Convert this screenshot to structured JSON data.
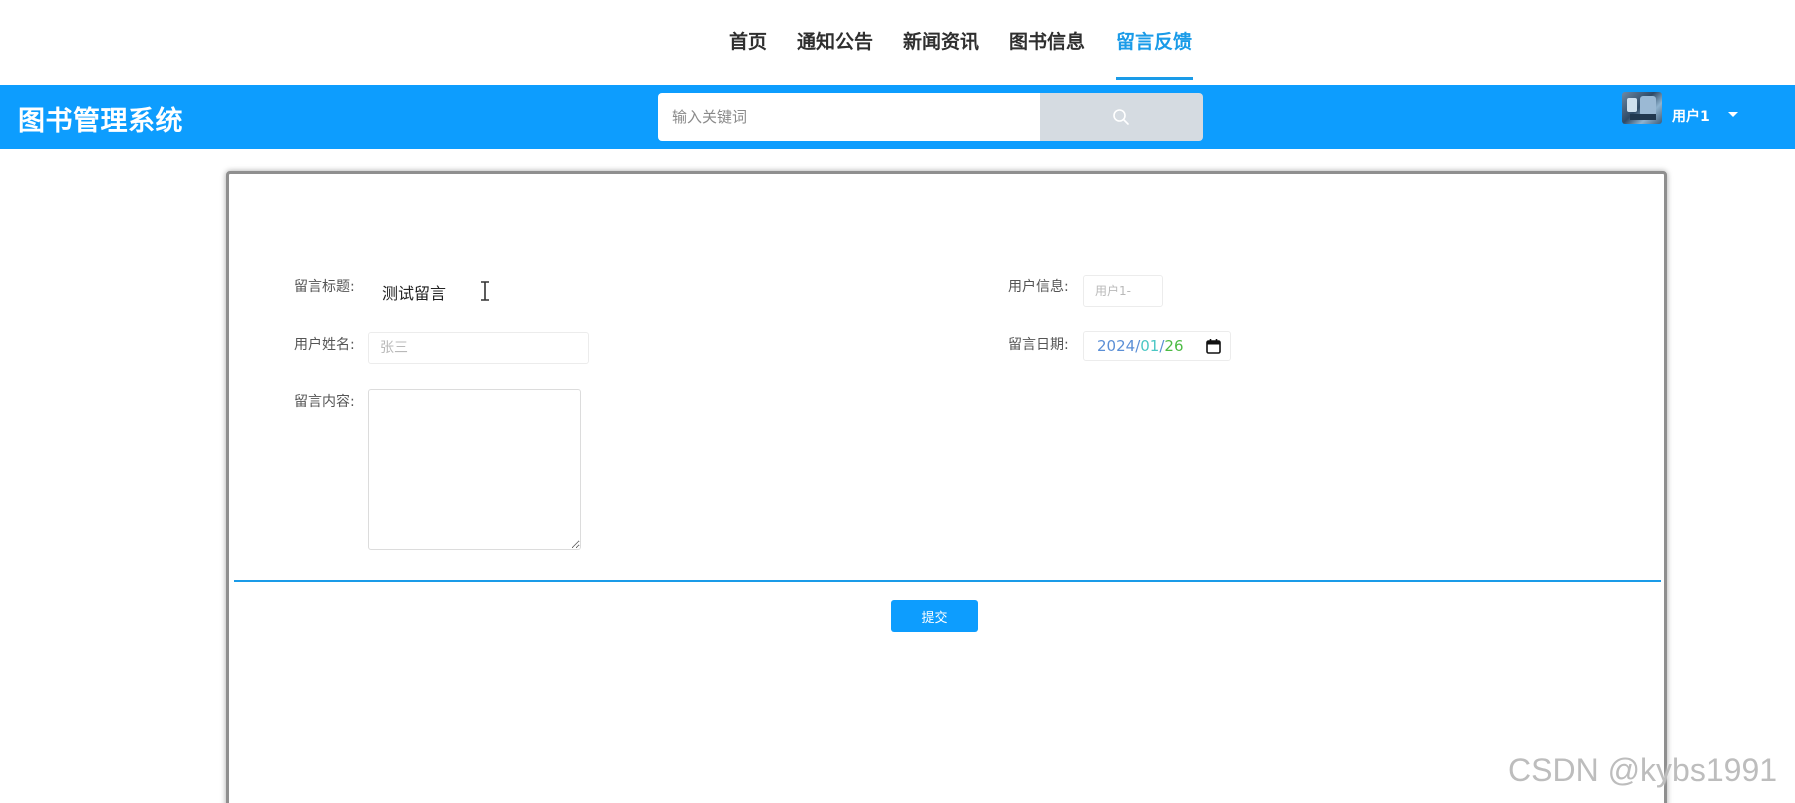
{
  "nav": {
    "items": [
      {
        "label": "首页"
      },
      {
        "label": "通知公告"
      },
      {
        "label": "新闻资讯"
      },
      {
        "label": "图书信息"
      },
      {
        "label": "留言反馈",
        "active": true
      }
    ]
  },
  "header": {
    "brand": "图书管理系统",
    "search_placeholder": "输入关键词",
    "search_icon": "search-icon",
    "username": "用户1",
    "bar_color": "#0d9dfe"
  },
  "form": {
    "title_label": "留言标题:",
    "title_value": "测试留言",
    "user_info_label": "用户信息:",
    "user_info_value": "用户1-",
    "user_name_label": "用户姓名:",
    "user_name_placeholder": "张三",
    "date_label": "留言日期:",
    "date_year": "2024",
    "date_month": "01",
    "date_day": "26",
    "date_separator": "/",
    "content_label": "留言内容:",
    "submit_label": "提交"
  },
  "watermark": "CSDN @kybs1991",
  "colors": {
    "accent": "#1a9be8",
    "header": "#0d9dfe"
  }
}
